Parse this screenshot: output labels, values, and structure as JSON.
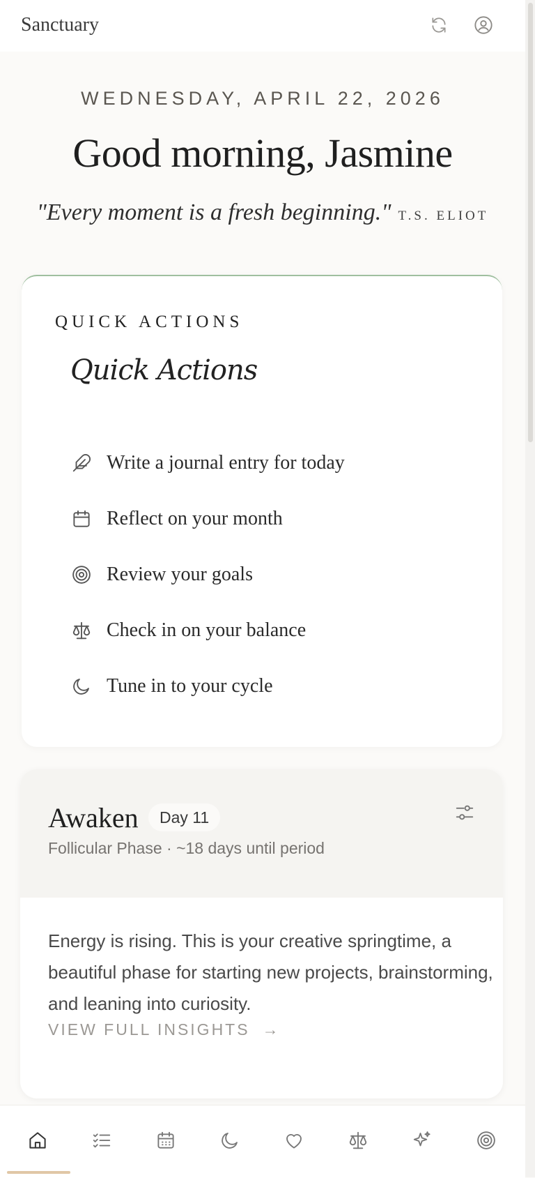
{
  "app": {
    "title": "Sanctuary"
  },
  "header": {
    "refresh_icon": "refresh-icon",
    "profile_icon": "user-circle-icon"
  },
  "hero": {
    "date": "WEDNESDAY, APRIL 22, 2026",
    "greeting": "Good morning, Jasmine",
    "quote": "\"Every moment is a fresh beginning.\"",
    "quote_author": "T.S. ELIOT"
  },
  "quick_actions": {
    "label": "QUICK ACTIONS",
    "script_title": "Quick Actions",
    "items": [
      {
        "label": "Write a journal entry for today",
        "icon": "feather-icon"
      },
      {
        "label": "Reflect on your month",
        "icon": "calendar-icon"
      },
      {
        "label": "Review your goals",
        "icon": "target-icon"
      },
      {
        "label": "Check in on your balance",
        "icon": "scale-icon"
      },
      {
        "label": "Tune in to your cycle",
        "icon": "moon-icon"
      }
    ]
  },
  "cycle": {
    "phase_title": "Awaken",
    "day": "Day 11",
    "subtitle": "Follicular Phase · ~18 days until period",
    "insight": "Energy is rising. This is your creative springtime, a beautiful phase for starting new projects, brainstorming, and leaning into curiosity.",
    "link": "VIEW FULL INSIGHTS",
    "link_arrow": "→"
  },
  "nav": {
    "items": [
      "home-icon",
      "checklist-icon",
      "calendar-icon",
      "moon-icon",
      "heart-icon",
      "scale-icon",
      "sparkle-icon",
      "target-icon"
    ],
    "active": "home-icon"
  },
  "colors": {
    "accent": "#9fbf9f",
    "indicator": "#e0c7a6",
    "background": "#fbfaf8"
  }
}
